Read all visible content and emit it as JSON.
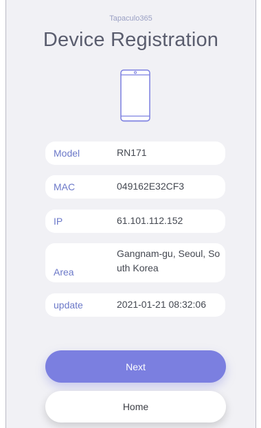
{
  "header": {
    "brand": "Tapaculo365",
    "title": "Device Registration"
  },
  "device": {
    "icon": "smartphone-icon"
  },
  "info": {
    "model_label": "Model",
    "model_value": "RN171",
    "mac_label": "MAC",
    "mac_value": "049162E32CF3",
    "ip_label": "IP",
    "ip_value": "61.101.112.152",
    "area_label": "Area",
    "area_value": "Gangnam-gu, Seoul, South Korea",
    "update_label": "update",
    "update_value": "2021-01-21 08:32:06"
  },
  "buttons": {
    "next_label": "Next",
    "home_label": "Home"
  },
  "colors": {
    "background": "#f1f1f5",
    "accent": "#7b7fe0",
    "label": "#6b78c8",
    "title": "#5a5d6e"
  }
}
